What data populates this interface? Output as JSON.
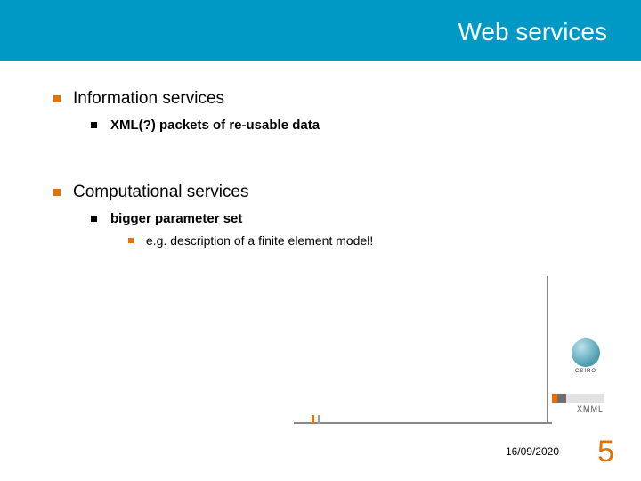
{
  "title": "Web services",
  "bullets": {
    "item1": {
      "label": "Information services",
      "sub1": "XML(?) packets of re-usable data"
    },
    "item2": {
      "label": "Computational services",
      "sub1": "bigger parameter set",
      "sub1_sub1": "e.g. description of a finite element model!"
    }
  },
  "logos": {
    "csiro": "CSIRO",
    "xmml": "XMML"
  },
  "footer": {
    "date": "16/09/2020",
    "page": "5"
  }
}
